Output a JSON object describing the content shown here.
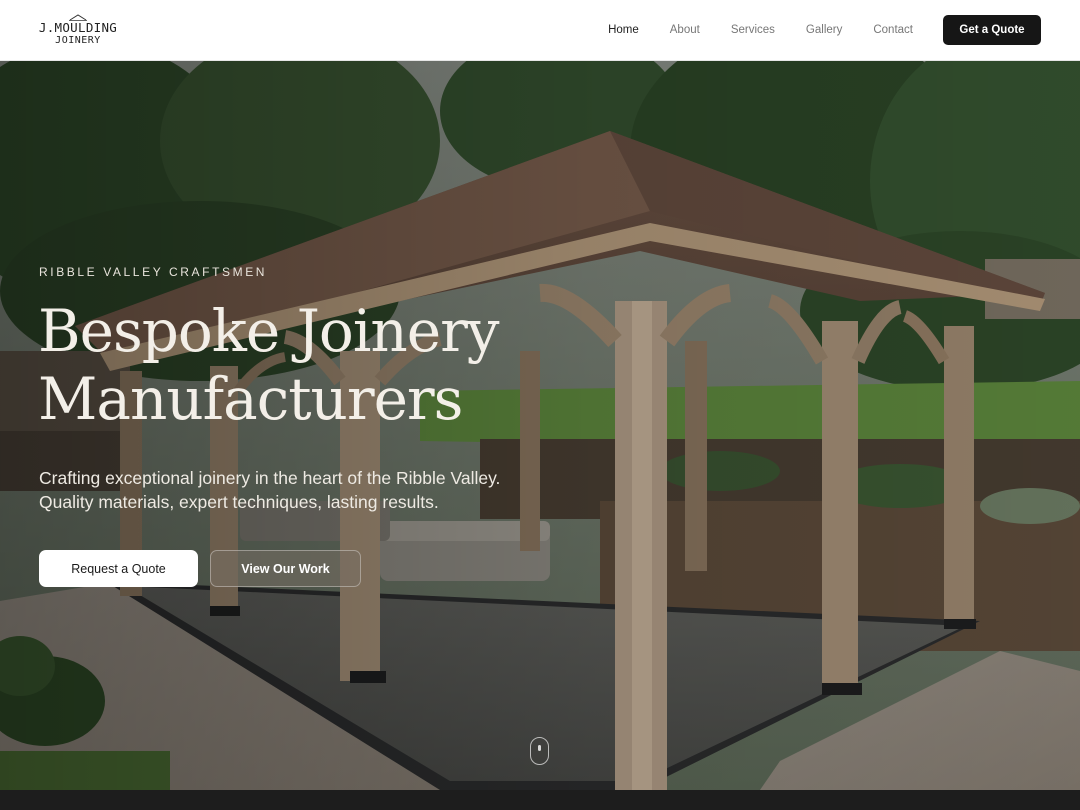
{
  "brand": {
    "line1": "J.MOULDING",
    "line2": "JOINERY",
    "logo_icon": "house-roof-icon"
  },
  "nav": {
    "items": [
      {
        "label": "Home",
        "active": true
      },
      {
        "label": "About",
        "active": false
      },
      {
        "label": "Services",
        "active": false
      },
      {
        "label": "Gallery",
        "active": false
      },
      {
        "label": "Contact",
        "active": false
      }
    ],
    "cta_label": "Get a Quote"
  },
  "hero": {
    "kicker": "RIBBLE VALLEY CRAFTSMEN",
    "title_line1": "Bespoke Joinery",
    "title_line2": "Manufacturers",
    "subtitle": "Crafting exceptional joinery in the heart of the Ribble Valley. Quality materials, expert techniques, lasting results.",
    "primary_button": "Request a Quote",
    "secondary_button": "View Our Work",
    "scroll_icon": "mouse-scroll-icon",
    "background_image": "oak-gazebo-garden-photo"
  },
  "colors": {
    "header_bg": "#ffffff",
    "cta_bg": "#161616",
    "nav_active": "#222222",
    "nav_inactive": "#777777",
    "footer_band": "#1d1d1d"
  }
}
